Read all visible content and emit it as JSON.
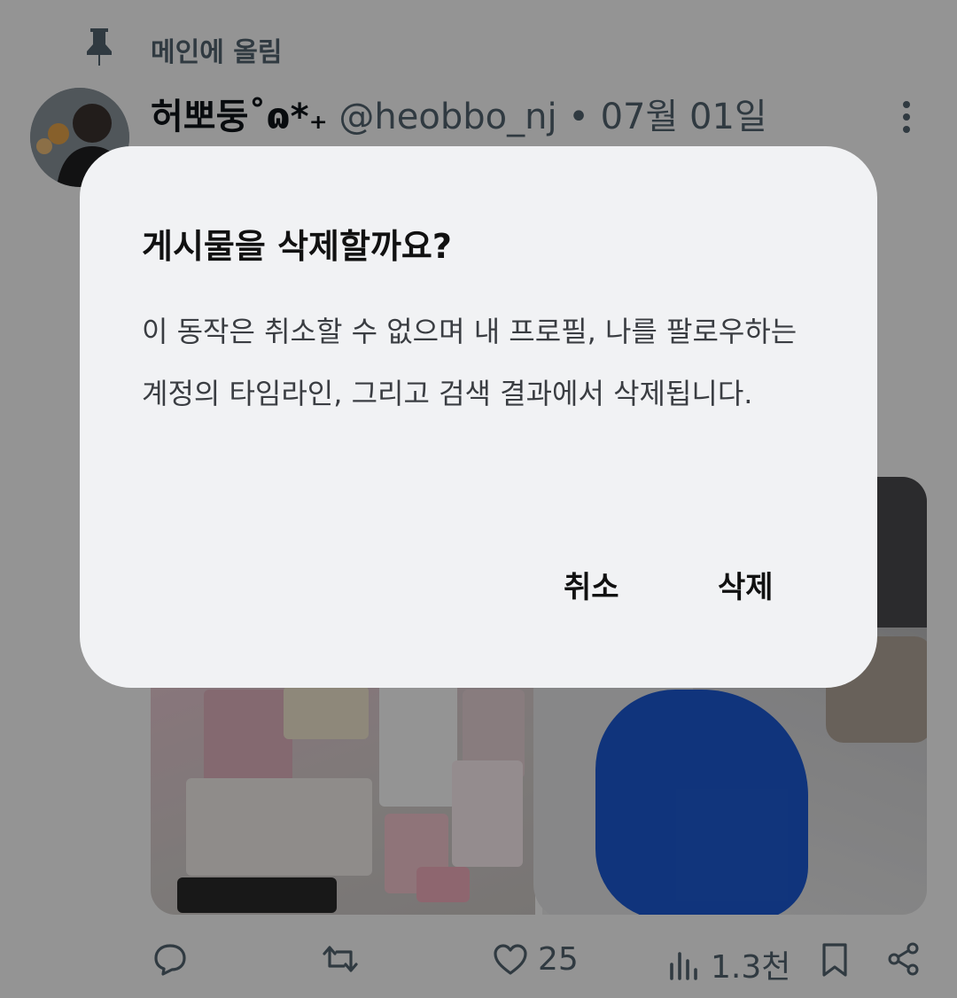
{
  "pinned": {
    "icon": "pin-icon",
    "label": "메인에 올림"
  },
  "tweet": {
    "display_name": "허뽀둥˚ɷ*₊",
    "handle": "@heobbo_nj",
    "separator": "•",
    "date": "07월 01일",
    "more_icon": "more-vertical-icon",
    "media": [
      {
        "name": "media-photo-wall"
      },
      {
        "name": "media-photo-selfie"
      }
    ],
    "actions": {
      "reply": {
        "icon": "reply-icon",
        "count": ""
      },
      "retweet": {
        "icon": "retweet-icon",
        "count": ""
      },
      "like": {
        "icon": "heart-icon",
        "count": "25"
      },
      "views": {
        "icon": "views-chart-icon",
        "count": "1.3천"
      },
      "bookmark": {
        "icon": "bookmark-icon",
        "count": ""
      },
      "share": {
        "icon": "share-icon",
        "count": ""
      }
    }
  },
  "dialog": {
    "title": "게시물을 삭제할까요?",
    "body": "이 동작은 취소할 수 없으며 내 프로필, 나를 팔로우하는 계정의 타임라인, 그리고 검색 결과에서 삭제됩니다.",
    "cancel_label": "취소",
    "delete_label": "삭제"
  },
  "colors": {
    "scrim": "#000000",
    "dialog_bg": "#f1f2f4",
    "secondary_text": "#536471"
  }
}
